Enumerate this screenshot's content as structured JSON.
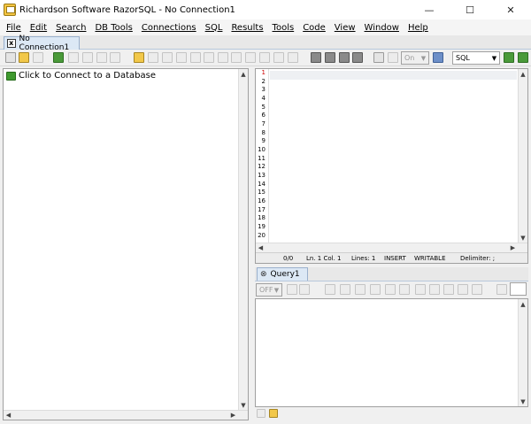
{
  "window": {
    "title": "Richardson Software RazorSQL - No Connection1",
    "minimize": "—",
    "maximize": "☐",
    "close": "✕"
  },
  "menu": [
    "File",
    "Edit",
    "Search",
    "DB Tools",
    "Connections",
    "SQL",
    "Results",
    "Tools",
    "Code",
    "View",
    "Window",
    "Help"
  ],
  "doc_tab": {
    "label": "No Connection1",
    "close": "x"
  },
  "toolbar": {
    "on_combo": "On",
    "language_combo": "SQL"
  },
  "tree": {
    "connect_label": "Click to Connect to a Database"
  },
  "editor": {
    "line_numbers": [
      "1",
      "2",
      "3",
      "4",
      "5",
      "6",
      "7",
      "8",
      "9",
      "10",
      "11",
      "12",
      "13",
      "14",
      "15",
      "16",
      "17",
      "18",
      "19",
      "20"
    ],
    "status": {
      "position": "0/0",
      "line_col": "Ln. 1 Col. 1",
      "lines": "Lines: 1",
      "mode": "INSERT",
      "writable": "WRITABLE",
      "delimiter": "Delimiter: ;"
    }
  },
  "query": {
    "tab_label": "Query1",
    "tab_close": "⊗",
    "off_combo": "OFF"
  },
  "colors": {
    "tab_bg": "#dce8f5",
    "connect_green": "#3f9a2f",
    "line_one_red": "#cc0000"
  }
}
